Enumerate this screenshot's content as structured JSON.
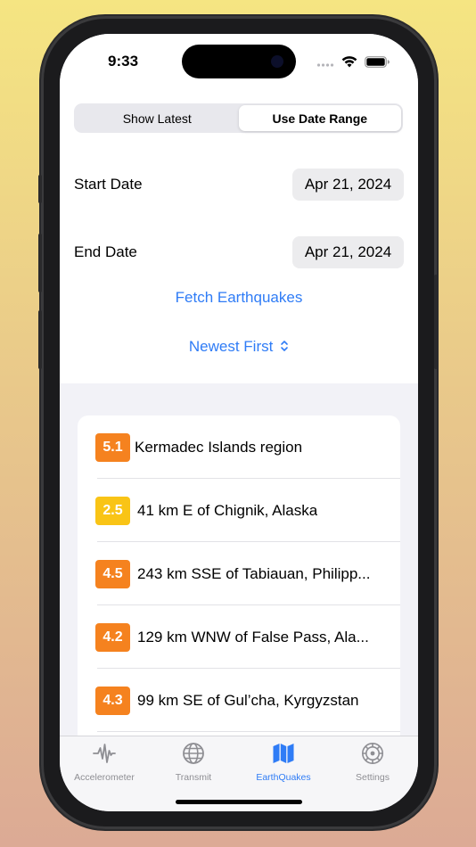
{
  "status": {
    "time": "9:33"
  },
  "segments": [
    {
      "label": "Show Latest",
      "active": false
    },
    {
      "label": "Use Date Range",
      "active": true
    }
  ],
  "start_date": {
    "label": "Start Date",
    "value": "Apr 21, 2024"
  },
  "end_date": {
    "label": "End Date",
    "value": "Apr 21, 2024"
  },
  "fetch_button": "Fetch Earthquakes",
  "sort_button": "Newest First",
  "quakes": [
    {
      "mag": "5.1",
      "place": "Kermadec Islands region",
      "color": "#f5821f"
    },
    {
      "mag": "2.5",
      "place": "41 km E of Chignik, Alaska",
      "color": "#f9c416"
    },
    {
      "mag": "4.5",
      "place": "243 km SSE of Tabiauan, Philipp...",
      "color": "#f5821f"
    },
    {
      "mag": "4.2",
      "place": "129 km WNW of False Pass, Ala...",
      "color": "#f5821f"
    },
    {
      "mag": "4.3",
      "place": "99 km SE of Gul’cha, Kyrgyzstan",
      "color": "#f5821f"
    }
  ],
  "tabs": [
    {
      "label": "Accelerometer",
      "icon": "waveform-icon",
      "active": false
    },
    {
      "label": "Transmit",
      "icon": "globe-icon",
      "active": false
    },
    {
      "label": "EarthQuakes",
      "icon": "map-icon",
      "active": true
    },
    {
      "label": "Settings",
      "icon": "gear-icon",
      "active": false
    }
  ],
  "colors": {
    "accent": "#2f7cf6",
    "orange": "#f5821f",
    "yellow": "#f9c416"
  }
}
